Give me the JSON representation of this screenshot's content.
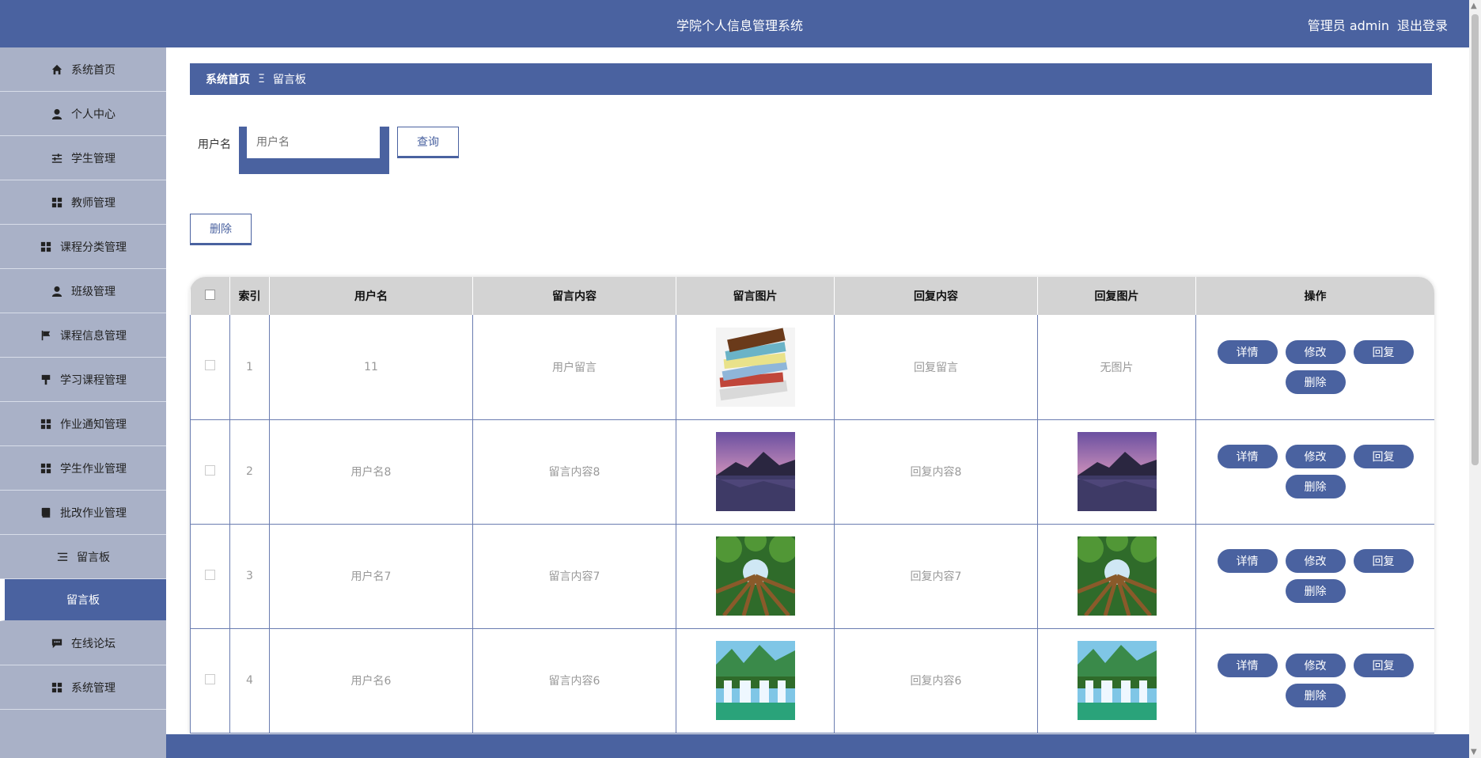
{
  "header": {
    "title": "学院个人信息管理系统",
    "user": "管理员 admin",
    "logout": "退出登录"
  },
  "sidebar": {
    "items": [
      {
        "label": "系统首页",
        "icon": "home-icon"
      },
      {
        "label": "个人中心",
        "icon": "user-icon"
      },
      {
        "label": "学生管理",
        "icon": "sliders-icon"
      },
      {
        "label": "教师管理",
        "icon": "grid-icon"
      },
      {
        "label": "课程分类管理",
        "icon": "grid-icon"
      },
      {
        "label": "班级管理",
        "icon": "person-icon"
      },
      {
        "label": "课程信息管理",
        "icon": "flag-icon"
      },
      {
        "label": "学习课程管理",
        "icon": "brush-icon"
      },
      {
        "label": "作业通知管理",
        "icon": "grid-icon"
      },
      {
        "label": "学生作业管理",
        "icon": "grid-icon"
      },
      {
        "label": "批改作业管理",
        "icon": "book-icon"
      },
      {
        "label": "留言板",
        "icon": "list-icon"
      }
    ],
    "sub_active": "留言板",
    "after": [
      {
        "label": "在线论坛",
        "icon": "chat-icon"
      },
      {
        "label": "系统管理",
        "icon": "grid-icon"
      }
    ]
  },
  "breadcrumb": {
    "home": "系统首页",
    "sep": "Ξ",
    "current": "留言板"
  },
  "search": {
    "label": "用户名",
    "placeholder": "用户名",
    "button": "查询"
  },
  "toolbar": {
    "delete": "删除"
  },
  "table": {
    "headers": [
      "索引",
      "用户名",
      "留言内容",
      "留言图片",
      "回复内容",
      "回复图片",
      "操作"
    ],
    "rows": [
      {
        "index": "1",
        "user": "11",
        "content": "用户留言",
        "img": "books",
        "reply": "回复留言",
        "reply_img": "无图片"
      },
      {
        "index": "2",
        "user": "用户名8",
        "content": "留言内容8",
        "img": "mountain",
        "reply": "回复内容8",
        "reply_img": "mountain"
      },
      {
        "index": "3",
        "user": "用户名7",
        "content": "留言内容7",
        "img": "forest",
        "reply": "回复内容7",
        "reply_img": "forest"
      },
      {
        "index": "4",
        "user": "用户名6",
        "content": "留言内容6",
        "img": "waterfall",
        "reply": "回复内容6",
        "reply_img": "waterfall"
      }
    ],
    "ops": [
      "详情",
      "修改",
      "回复",
      "删除"
    ]
  },
  "colors": {
    "primary": "#4a62a0",
    "sidebar": "#a9b1c7"
  }
}
